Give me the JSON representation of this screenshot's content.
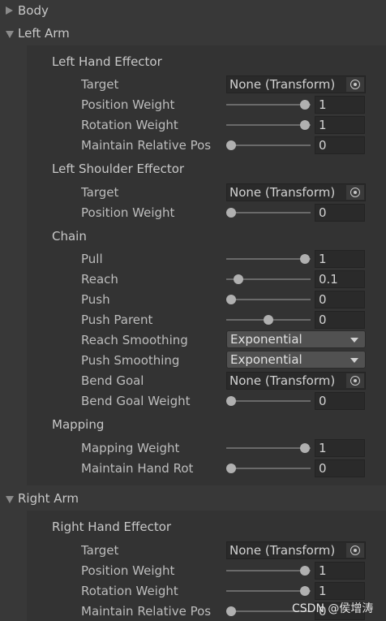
{
  "body_foldout": "Body",
  "left_arm": {
    "title": "Left Arm",
    "hand": {
      "title": "Left Hand Effector",
      "target_label": "Target",
      "target_value": "None (Transform)",
      "position_weight_label": "Position Weight",
      "position_weight": "1",
      "rotation_weight_label": "Rotation Weight",
      "rotation_weight": "1",
      "maintain_label": "Maintain Relative Pos",
      "maintain": "0"
    },
    "shoulder": {
      "title": "Left Shoulder Effector",
      "target_label": "Target",
      "target_value": "None (Transform)",
      "position_weight_label": "Position Weight",
      "position_weight": "0"
    },
    "chain": {
      "title": "Chain",
      "pull_label": "Pull",
      "pull": "1",
      "reach_label": "Reach",
      "reach": "0.1",
      "push_label": "Push",
      "push": "0",
      "push_parent_label": "Push Parent",
      "push_parent": "0",
      "reach_smoothing_label": "Reach Smoothing",
      "reach_smoothing": "Exponential",
      "push_smoothing_label": "Push Smoothing",
      "push_smoothing": "Exponential",
      "bend_goal_label": "Bend Goal",
      "bend_goal": "None (Transform)",
      "bend_goal_weight_label": "Bend Goal Weight",
      "bend_goal_weight": "0"
    },
    "mapping": {
      "title": "Mapping",
      "mapping_weight_label": "Mapping Weight",
      "mapping_weight": "1",
      "maintain_hand_rot_label": "Maintain Hand Rot",
      "maintain_hand_rot": "0"
    }
  },
  "right_arm": {
    "title": "Right Arm",
    "hand": {
      "title": "Right Hand Effector",
      "target_label": "Target",
      "target_value": "None (Transform)",
      "position_weight_label": "Position Weight",
      "position_weight": "1",
      "rotation_weight_label": "Rotation Weight",
      "rotation_weight": "1",
      "maintain_label": "Maintain Relative Pos",
      "maintain": "0"
    }
  },
  "watermark": "CSDN @侯增涛",
  "slider_fill": {
    "la_pos_weight": 1,
    "la_rot_weight": 1,
    "la_maintain": 0,
    "ls_pos_weight": 0,
    "pull": 1,
    "reach": 0.1,
    "push": 0,
    "push_parent": 0.5,
    "bend_goal_weight": 0,
    "mapping_weight": 1,
    "maintain_hand_rot": 0,
    "ra_pos_weight": 1,
    "ra_rot_weight": 1,
    "ra_maintain": 0
  }
}
